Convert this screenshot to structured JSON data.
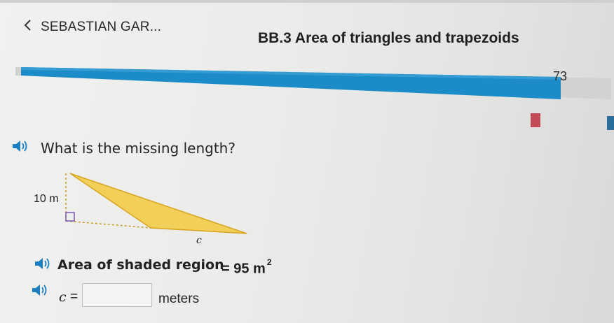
{
  "header": {
    "student_name": "SEBASTIAN GAR...",
    "skill_title": "BB.3 Area of triangles and trapezoids"
  },
  "progress": {
    "score": "73",
    "fill_fraction": 0.94,
    "accent": "#1b8cc8",
    "flag_colors": [
      "#c24a59",
      "#2a6f9c"
    ]
  },
  "question": {
    "text": "What is the missing length?"
  },
  "figure": {
    "height_label": "10 m",
    "base_label": "c",
    "fill_color": "#f2cf58",
    "stroke_color": "#d9a520"
  },
  "given": {
    "label": "Area of shaded region",
    "equation": "= 95 m",
    "exponent": "2"
  },
  "answer": {
    "variable": "c",
    "equals": "=",
    "value": "",
    "unit": "meters"
  },
  "icons": [
    "chevron-left-icon",
    "speaker-icon",
    "bookmark-flag-icon"
  ]
}
